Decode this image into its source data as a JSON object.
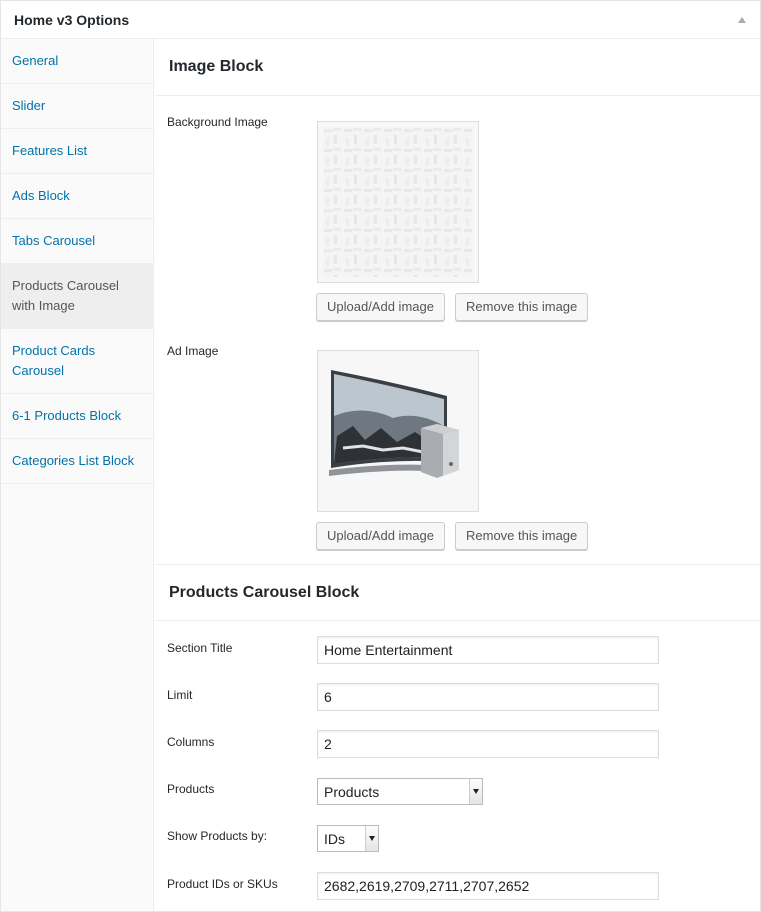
{
  "metabox": {
    "title": "Home v3 Options"
  },
  "tabs": [
    {
      "label": "General"
    },
    {
      "label": "Slider"
    },
    {
      "label": "Features List"
    },
    {
      "label": "Ads Block"
    },
    {
      "label": "Tabs Carousel"
    },
    {
      "label": "Products Carousel with Image"
    },
    {
      "label": "Product Cards Carousel"
    },
    {
      "label": "6-1 Products Block"
    },
    {
      "label": "Categories List Block"
    }
  ],
  "active_tab": "Products Carousel with Image",
  "image_block": {
    "title": "Image Block",
    "background_image": {
      "label": "Background Image",
      "upload_label": "Upload/Add image",
      "remove_label": "Remove this image"
    },
    "ad_image": {
      "label": "Ad Image",
      "upload_label": "Upload/Add image",
      "remove_label": "Remove this image"
    }
  },
  "carousel_block": {
    "title": "Products Carousel Block",
    "section_title": {
      "label": "Section Title",
      "value": "Home Entertainment"
    },
    "limit": {
      "label": "Limit",
      "value": "6"
    },
    "columns": {
      "label": "Columns",
      "value": "2"
    },
    "products": {
      "label": "Products",
      "value": "Products"
    },
    "show_by": {
      "label": "Show Products by:",
      "value": "IDs"
    },
    "product_ids": {
      "label": "Product IDs or SKUs",
      "value": "2682,2619,2709,2711,2707,2652"
    }
  },
  "colors": {
    "link": "#0073aa",
    "active_tab_bg": "#eeeeee"
  }
}
